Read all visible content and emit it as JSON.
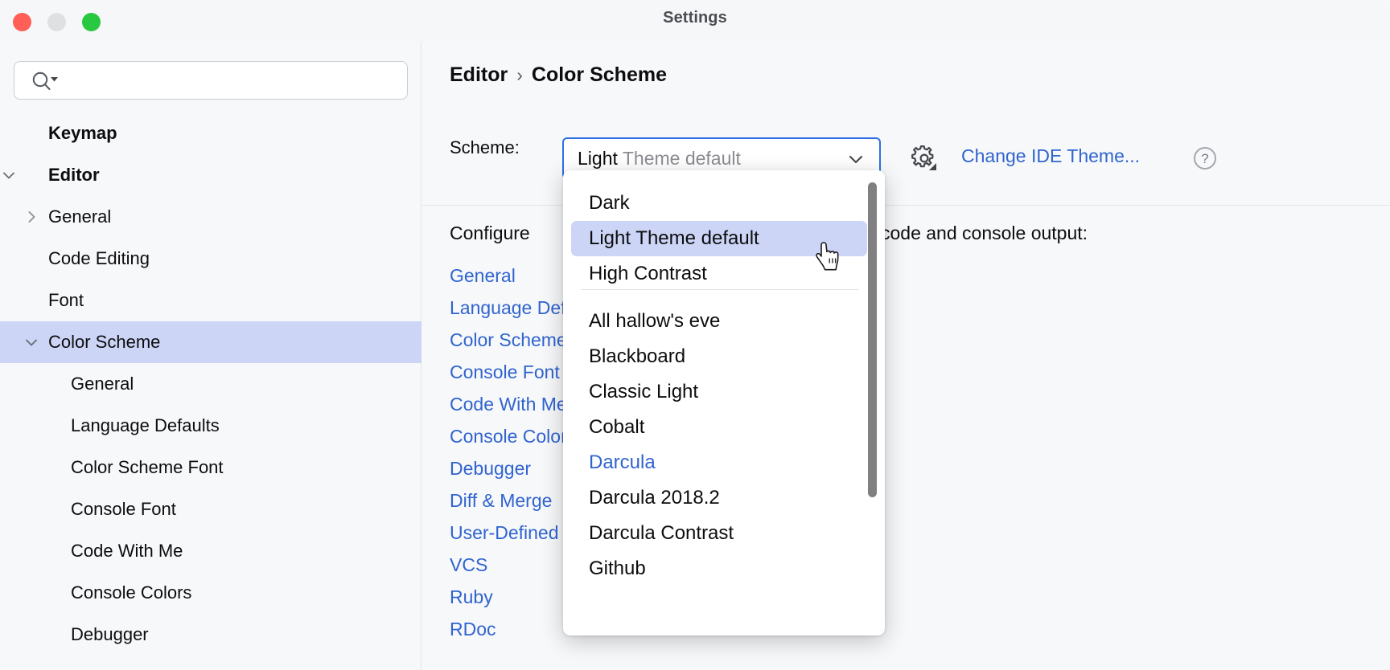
{
  "window": {
    "title": "Settings",
    "controls": [
      "close-button",
      "minimize-button",
      "maximize-button"
    ]
  },
  "search": {
    "value": "",
    "placeholder": "",
    "icon": "search-icon"
  },
  "sidebar": {
    "items": [
      {
        "label": "Keymap",
        "indent": 0,
        "bold": true,
        "twisty": "none",
        "selected": false
      },
      {
        "label": "Editor",
        "indent": 0,
        "bold": true,
        "twisty": "expanded",
        "selected": false
      },
      {
        "label": "General",
        "indent": 1,
        "bold": false,
        "twisty": "collapsed",
        "selected": false
      },
      {
        "label": "Code Editing",
        "indent": 1,
        "bold": false,
        "twisty": "none",
        "selected": false
      },
      {
        "label": "Font",
        "indent": 1,
        "bold": false,
        "twisty": "none",
        "selected": false
      },
      {
        "label": "Color Scheme",
        "indent": 1,
        "bold": false,
        "twisty": "expanded",
        "selected": true
      },
      {
        "label": "General",
        "indent": 2,
        "bold": false,
        "twisty": "none",
        "selected": false
      },
      {
        "label": "Language Defaults",
        "indent": 2,
        "bold": false,
        "twisty": "none",
        "selected": false
      },
      {
        "label": "Color Scheme Font",
        "indent": 2,
        "bold": false,
        "twisty": "none",
        "selected": false
      },
      {
        "label": "Console Font",
        "indent": 2,
        "bold": false,
        "twisty": "none",
        "selected": false
      },
      {
        "label": "Code With Me",
        "indent": 2,
        "bold": false,
        "twisty": "none",
        "selected": false
      },
      {
        "label": "Console Colors",
        "indent": 2,
        "bold": false,
        "twisty": "none",
        "selected": false
      },
      {
        "label": "Debugger",
        "indent": 2,
        "bold": false,
        "twisty": "none",
        "selected": false
      }
    ]
  },
  "main": {
    "breadcrumb": {
      "root": "Editor",
      "separator": "›",
      "current": "Color Scheme"
    },
    "scheme": {
      "label": "Scheme:",
      "value_strong": "Light",
      "value_dim": "Theme default",
      "chevron": "chevron-down-icon",
      "gear_icon": "gear-icon",
      "theme_link": "Change IDE Theme...",
      "help_icon": "?"
    },
    "configure_head": "Configure",
    "configure_tail": "code and console output:",
    "links": [
      "General",
      "Language Defaults",
      "Color Scheme Font",
      "Console Font",
      "Code With Me",
      "Console Colors",
      "Debugger",
      "Diff & Merge",
      "User-Defined",
      "VCS",
      "Ruby",
      "RDoc"
    ]
  },
  "dropdown": {
    "options": [
      {
        "label": "Dark",
        "highlight": false,
        "accent": false
      },
      {
        "label": "Light Theme default",
        "highlight": true,
        "accent": false
      },
      {
        "label": "High Contrast",
        "highlight": false,
        "accent": false
      },
      {
        "label": "All hallow's eve",
        "highlight": false,
        "accent": false
      },
      {
        "label": "Blackboard",
        "highlight": false,
        "accent": false
      },
      {
        "label": "Classic Light",
        "highlight": false,
        "accent": false
      },
      {
        "label": "Cobalt",
        "highlight": false,
        "accent": false
      },
      {
        "label": "Darcula",
        "highlight": false,
        "accent": true
      },
      {
        "label": "Darcula 2018.2",
        "highlight": false,
        "accent": false
      },
      {
        "label": "Darcula Contrast",
        "highlight": false,
        "accent": false
      },
      {
        "label": "Github",
        "highlight": false,
        "accent": false
      }
    ],
    "separator_after_index": 2,
    "scrollbar": "vertical-scrollbar"
  },
  "colors": {
    "accent_blue": "#3064cf",
    "focus_blue": "#2f6fe4",
    "selection_blue": "#ccd5f5",
    "window_bg": "#f7f8fa",
    "text": "#0d0d0f",
    "dim_text": "#8b8d93",
    "close_red": "#ff5f57",
    "min_gray": "#dfe0e2",
    "zoom_green": "#28c840"
  },
  "cursor": {
    "type": "pointing-hand-cursor"
  }
}
